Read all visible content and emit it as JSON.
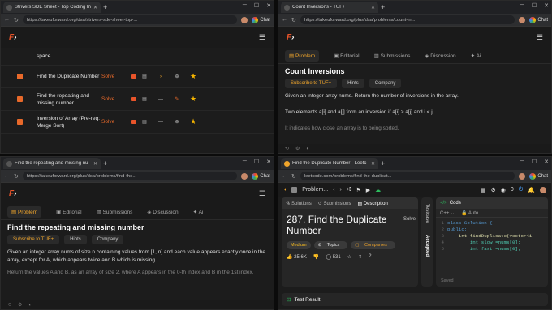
{
  "w1": {
    "tab": "Strivers SDE Sheet - Top Coding In",
    "url": "https://takeuforward.org/dsa/strivers-sde-sheet-top-...",
    "rows": [
      {
        "name": "space",
        "solve": ""
      },
      {
        "name": "Find the Duplicate Number",
        "solve": "Solve"
      },
      {
        "name": "Find the repeating and missing number",
        "solve": "Solve"
      },
      {
        "name": "Inversion of Array (Pre-req: Merge Sort)",
        "solve": "Solve"
      }
    ]
  },
  "w2": {
    "tab": "Count Inversions - TUF+",
    "url": "https://takeuforward.org/plus/dsa/problems/count-in...",
    "tabs": [
      "Problem",
      "Editorial",
      "Submissions",
      "Discussion",
      "Ai"
    ],
    "title": "Count Inversions",
    "chips": [
      "Subscribe to TUF+",
      "Hints",
      "Company"
    ],
    "p1": "Given an integer array nums. Return the number of inversions in the array.",
    "p2": "Two elements a[i] and a[j] form an inversion if a[i] > a[j] and i < j.",
    "p3": "It indicates how close an array is to being sorted."
  },
  "w3": {
    "tab": "Find the repeating and missing nu",
    "url": "https://takeuforward.org/plus/dsa/problems/find-the...",
    "tabs": [
      "Problem",
      "Editorial",
      "Submissions",
      "Discussion",
      "Ai"
    ],
    "title": "Find the repeating and missing number",
    "chips": [
      "Subscribe to TUF+",
      "Hints",
      "Company"
    ],
    "p1": "Given an integer array nums of size n containing values from [1, n] and each value appears exactly once in the array, except for A, which appears twice and B which is missing.",
    "p2": "Return the values A and B, as an array of size 2, where A appears in the 0-th index and B in the 1st index."
  },
  "w4": {
    "tab": "Find the Duplicate Number - Leetc",
    "url": "leetcode.com/problems/find-the-duplicat...",
    "lctitle": "Problem...",
    "coins": "0",
    "ltabs": [
      "Solutions",
      "Submissions",
      "Description"
    ],
    "title": "287. Find the Duplicate Number",
    "solve": "Solve",
    "chips": [
      "Medium",
      "Topics",
      "Companies"
    ],
    "likes": "25.6K",
    "comments": "531",
    "vtabs": [
      "Testcase",
      "Accepted"
    ],
    "codeh": "Code",
    "lang": "C++",
    "auto": "Auto",
    "code": [
      "class Solution {",
      "public:",
      "    int findDuplicate(vector<i",
      "        int slow =nums[0];",
      "        int fast =nums[0];"
    ],
    "lines": [
      "1",
      "2",
      "3",
      "4",
      "5"
    ],
    "saved": "Saved",
    "test": "Test Result"
  },
  "chat": "Chat"
}
